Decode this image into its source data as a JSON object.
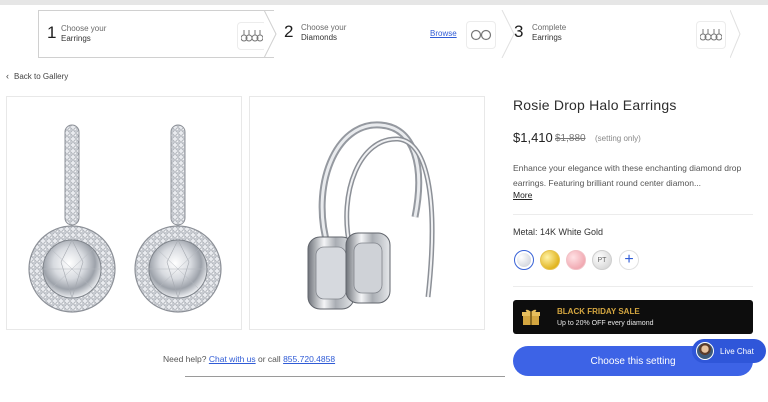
{
  "stepper": {
    "steps": [
      {
        "num": "1",
        "label_line1": "Choose your",
        "label_line2": "Earrings",
        "icon": "earrings-icon"
      },
      {
        "num": "2",
        "label_line1": "Choose your",
        "label_line2": "Diamonds",
        "action": "Browse",
        "icon": "ring-pair-icon"
      },
      {
        "num": "3",
        "label_line1": "Complete",
        "label_line2": "Earrings",
        "icon": "earrings-icon"
      }
    ]
  },
  "nav": {
    "back_label": "Back to Gallery"
  },
  "product": {
    "title": "Rosie Drop Halo Earrings",
    "price": "$1,410",
    "price_old": "$1,880",
    "price_note": "(setting only)",
    "description": "Enhance your elegance with these enchanting diamond drop earrings. Featuring brilliant round center diamon...",
    "more_label": "More",
    "metal_label": "Metal: 14K White Gold",
    "swatches": [
      {
        "name": "white-gold",
        "color": "#d0d4dc",
        "selected": true
      },
      {
        "name": "yellow-gold",
        "color": "#e0b21a"
      },
      {
        "name": "rose-gold",
        "color": "#f0a7b0"
      },
      {
        "name": "platinum",
        "color": "#d9d9d9",
        "label": "PT"
      },
      {
        "name": "more",
        "label": "+"
      }
    ]
  },
  "promo": {
    "title": "BLACK FRIDAY SALE",
    "subtitle": "Up to 20% OFF every diamond"
  },
  "cta": {
    "label": "Choose this setting"
  },
  "live_chat": {
    "label": "Live Chat"
  },
  "help": {
    "prefix": "Need help?",
    "chat_link": "Chat with us",
    "middle": "or call",
    "phone": "855.720.4858"
  },
  "colors": {
    "accent": "#3d63e6",
    "link": "#2f5bd6",
    "promo_bg": "#0d0d0d",
    "promo_gold": "#d4a640"
  }
}
